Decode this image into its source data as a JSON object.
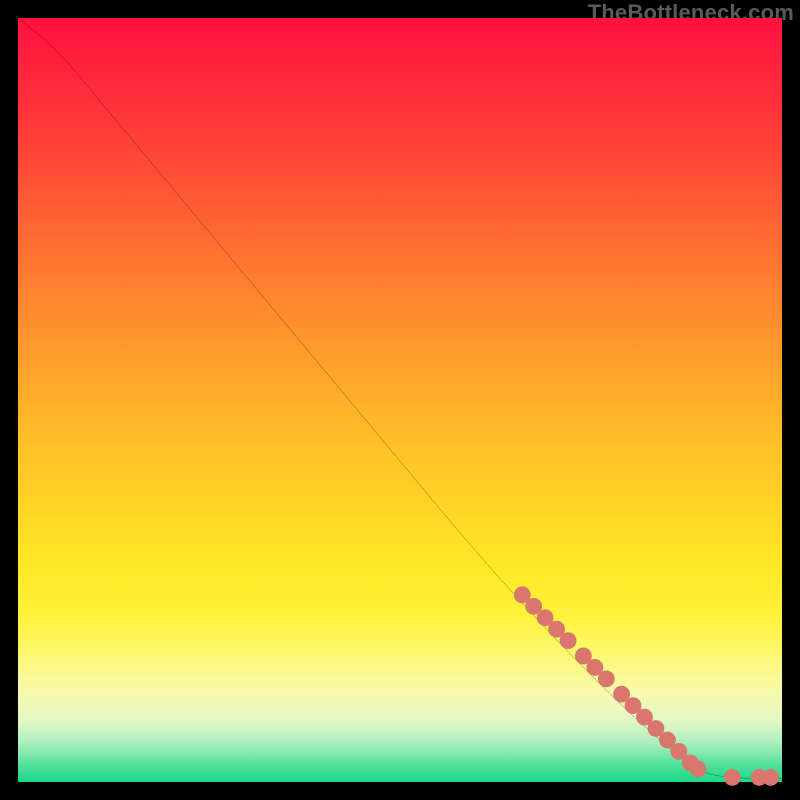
{
  "watermark": "TheBottleneck.com",
  "chart_data": {
    "type": "line",
    "title": "",
    "xlabel": "",
    "ylabel": "",
    "xlim": [
      0,
      100
    ],
    "ylim": [
      0,
      100
    ],
    "curve": [
      {
        "x": 0,
        "y": 100
      },
      {
        "x": 5,
        "y": 96
      },
      {
        "x": 10,
        "y": 90
      },
      {
        "x": 20,
        "y": 78
      },
      {
        "x": 30,
        "y": 66
      },
      {
        "x": 40,
        "y": 54
      },
      {
        "x": 50,
        "y": 42
      },
      {
        "x": 60,
        "y": 30
      },
      {
        "x": 70,
        "y": 19
      },
      {
        "x": 80,
        "y": 9
      },
      {
        "x": 88,
        "y": 2
      },
      {
        "x": 92,
        "y": 0.5
      },
      {
        "x": 100,
        "y": 0.5
      }
    ],
    "points": [
      {
        "x": 66,
        "y": 24.5
      },
      {
        "x": 67.5,
        "y": 23
      },
      {
        "x": 69,
        "y": 21.5
      },
      {
        "x": 70.5,
        "y": 20
      },
      {
        "x": 72,
        "y": 18.5
      },
      {
        "x": 74,
        "y": 16.5
      },
      {
        "x": 75.5,
        "y": 15
      },
      {
        "x": 77,
        "y": 13.5
      },
      {
        "x": 79,
        "y": 11.5
      },
      {
        "x": 80.5,
        "y": 10
      },
      {
        "x": 82,
        "y": 8.5
      },
      {
        "x": 83.5,
        "y": 7
      },
      {
        "x": 85,
        "y": 5.5
      },
      {
        "x": 86.5,
        "y": 4
      },
      {
        "x": 88,
        "y": 2.5
      },
      {
        "x": 89,
        "y": 1.7
      },
      {
        "x": 93.5,
        "y": 0.6
      },
      {
        "x": 97,
        "y": 0.6
      },
      {
        "x": 98.5,
        "y": 0.6
      }
    ],
    "point_radius": 1.1
  }
}
